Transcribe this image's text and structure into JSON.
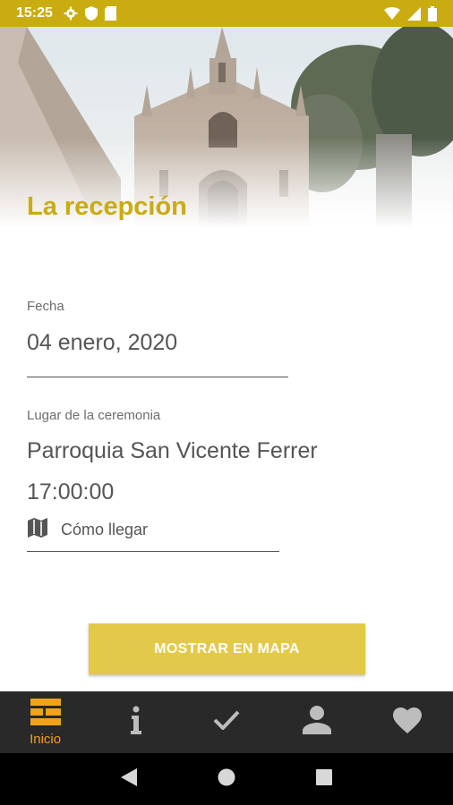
{
  "status_bar": {
    "time": "15:25",
    "left_icons": [
      "gear-icon",
      "shield-icon",
      "sim-card-icon"
    ],
    "right_icons": [
      "wifi-icon",
      "signal-icon",
      "battery-icon"
    ],
    "color": "#c9ac0f"
  },
  "hero": {
    "title": "La recepción",
    "image": "church-facade"
  },
  "date_section": {
    "label": "Fecha",
    "value": "04 enero, 2020"
  },
  "place_section": {
    "label": "Lugar de la ceremonia",
    "name": "Parroquia San Vicente Ferrer",
    "time": "17:00:00",
    "directions_label": "Cómo llegar",
    "directions_icon": "map-icon"
  },
  "map_button": {
    "label": "MOSTRAR EN MAPA",
    "color": "#e3c949"
  },
  "bottom_nav": {
    "items": [
      {
        "label": "Inicio",
        "icon": "home-grid-icon",
        "active": true
      },
      {
        "label": "",
        "icon": "info-icon",
        "active": false
      },
      {
        "label": "",
        "icon": "check-icon",
        "active": false
      },
      {
        "label": "",
        "icon": "person-icon",
        "active": false
      },
      {
        "label": "",
        "icon": "heart-icon",
        "active": false
      }
    ],
    "active_color": "#f0a21a"
  },
  "system_nav": {
    "buttons": [
      "back-icon",
      "home-icon",
      "recents-icon"
    ]
  }
}
